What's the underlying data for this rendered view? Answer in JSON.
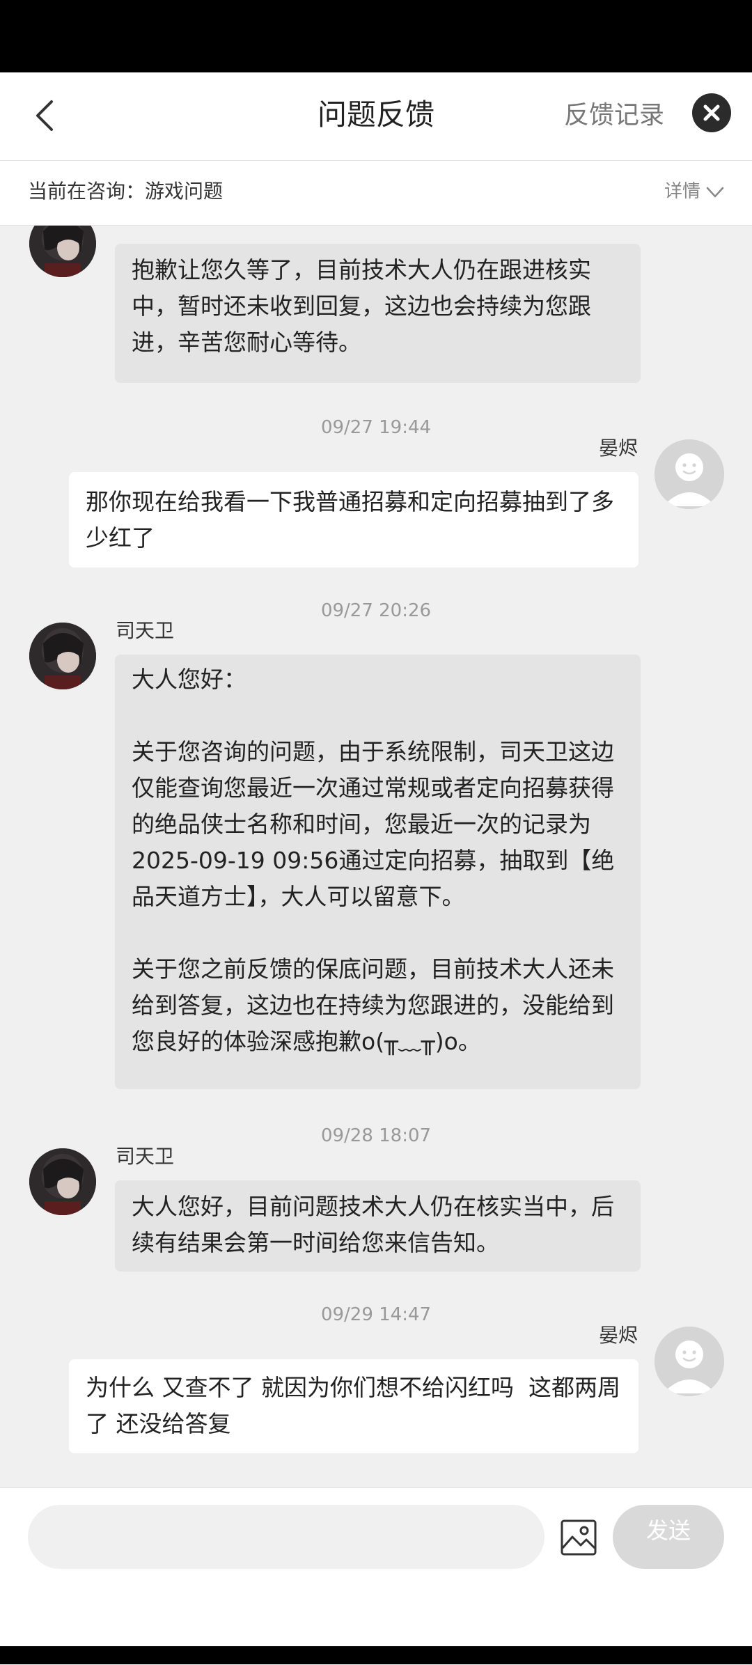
{
  "header": {
    "title": "问题反馈",
    "records_label": "反馈记录"
  },
  "consult": {
    "label": "当前在咨询：游戏问题",
    "detail_label": "详情"
  },
  "agent_name": "司天卫",
  "user_name": "晏烬",
  "messages": [
    {
      "text": "抱歉让您久等了，目前技术大人仍在跟进核实中，暂时还未收到回复，这边也会持续为您跟进，辛苦您耐心等待。"
    },
    {
      "time": "09/27 19:44",
      "text": "那你现在给我看一下我普通招募和定向招募抽到了多少红了"
    },
    {
      "time": "09/27 20:26",
      "text": "大人您好：\n\n关于您咨询的问题，由于系统限制，司天卫这边仅能查询您最近一次通过常规或者定向招募获得的绝品侠士名称和时间，您最近一次的记录为2025-09-19 09:56通过定向招募，抽取到【绝品天道方士】，大人可以留意下。\n\n关于您之前反馈的保底问题，目前技术大人还未给到答复，这边也在持续为您跟进的，没能给到您良好的体验深感抱歉o(╥﹏╥)o。"
    },
    {
      "time": "09/28 18:07",
      "text": "大人您好，目前问题技术大人仍在核实当中，后续有结果会第一时间给您来信告知。"
    },
    {
      "time": "09/29 14:47",
      "text": "为什么 又查不了 就因为你们想不给闪红吗  这都两周了 还没给答复"
    }
  ],
  "input": {
    "placeholder": "",
    "send_label": "发送"
  },
  "icons": {
    "back": "back-arrow-icon",
    "close": "close-icon",
    "detail": "chevron-down-icon",
    "image": "image-icon",
    "user_avatar": "default-avatar-icon"
  },
  "colors": {
    "chat_bg": "#f0f0f0",
    "agent_bubble": "#e4e4e4",
    "user_bubble": "#ffffff",
    "send_disabled": "#d9d9d9"
  }
}
